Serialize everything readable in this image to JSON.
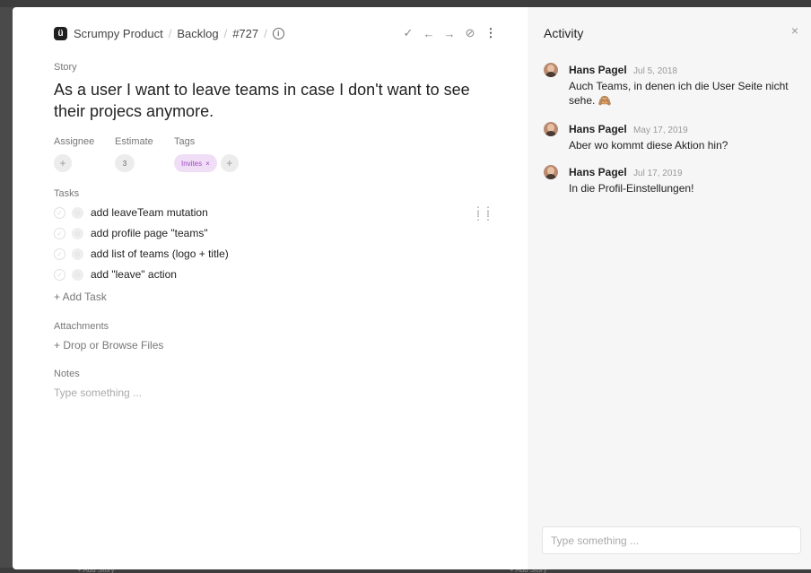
{
  "breadcrumb": {
    "logo_letter": "ü",
    "project": "Scrumpy Product",
    "sep1": "/",
    "board": "Backlog",
    "sep2": "/",
    "issue": "#727",
    "sep3": "/"
  },
  "toolbar": {
    "check_icon": "✓",
    "prev_icon": "←",
    "next_icon": "→",
    "hide_icon": "⊘",
    "more_icon": "⋮"
  },
  "story": {
    "type_label": "Story",
    "title": "As a user I want to leave teams in case I don't want to see their projecs anymore."
  },
  "meta": {
    "assignee_label": "Assignee",
    "estimate_label": "Estimate",
    "estimate_value": "3",
    "tags_label": "Tags",
    "tags": [
      {
        "label": "Invites",
        "remove": "×",
        "color": "#a146c4"
      }
    ],
    "add_symbol": "+"
  },
  "tasks": {
    "label": "Tasks",
    "items": [
      {
        "title": "add leaveTeam mutation"
      },
      {
        "title": "add profile page \"teams\""
      },
      {
        "title": "add list of teams (logo + title)"
      },
      {
        "title": "add \"leave\" action"
      }
    ],
    "add_label": "+  Add Task"
  },
  "attachments": {
    "label": "Attachments",
    "drop_label": "+  Drop or Browse Files"
  },
  "notes": {
    "label": "Notes",
    "placeholder": "Type something ..."
  },
  "activity": {
    "title": "Activity",
    "close": "×",
    "comments": [
      {
        "author": "Hans Pagel",
        "date": "Jul 5, 2018",
        "text": "Auch Teams, in denen ich die User Seite nicht sehe. 🙈"
      },
      {
        "author": "Hans Pagel",
        "date": "May 17, 2019",
        "text": "Aber wo kommt diese Aktion hin?"
      },
      {
        "author": "Hans Pagel",
        "date": "Jul 17, 2019",
        "text": "In die Profil-Einstellungen!"
      }
    ],
    "input_placeholder": "Type something ..."
  },
  "backdrop": {
    "bottom_left": "+ Add Story",
    "bottom_right": "+ Add Story"
  }
}
